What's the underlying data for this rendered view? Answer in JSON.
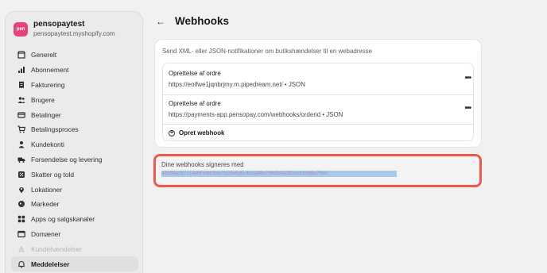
{
  "store": {
    "avatar_text": "pen",
    "name": "pensopaytest",
    "domain": "pensopaytest.myshopify.com"
  },
  "nav": [
    {
      "label": "Generelt",
      "icon": "store-icon"
    },
    {
      "label": "Abonnement",
      "icon": "plan-icon"
    },
    {
      "label": "Fakturering",
      "icon": "receipt-icon"
    },
    {
      "label": "Brugere",
      "icon": "users-icon"
    },
    {
      "label": "Betalinger",
      "icon": "card-icon"
    },
    {
      "label": "Betalingsproces",
      "icon": "cart-icon"
    },
    {
      "label": "Kundekonti",
      "icon": "person-icon"
    },
    {
      "label": "Forsendelse og levering",
      "icon": "truck-icon"
    },
    {
      "label": "Skatter og told",
      "icon": "tax-icon"
    },
    {
      "label": "Lokationer",
      "icon": "pin-icon"
    },
    {
      "label": "Markeder",
      "icon": "globe-icon"
    },
    {
      "label": "Apps og salgskanaler",
      "icon": "apps-icon"
    },
    {
      "label": "Domæner",
      "icon": "domain-icon"
    },
    {
      "label": "Kundehændelser",
      "icon": "events-icon"
    },
    {
      "label": "Meddelelser",
      "icon": "bell-icon"
    }
  ],
  "header": {
    "back_icon": "arrow-left-icon",
    "title": "Webhooks"
  },
  "card": {
    "description": "Send XML- eller JSON-notifikationer om butikshændelser til en webadresse",
    "webhooks": [
      {
        "title": "Oprettelse af ordre",
        "url": "https://eoifwe1jqnbrjmy.m.pipedream.net/ • JSON"
      },
      {
        "title": "Oprettelse af ordre",
        "url": "https://payments-app.pensopay.com/webhooks/orderid • JSON"
      }
    ],
    "more_label": "•••",
    "create_label": "Opret webhook"
  },
  "signing": {
    "label": "Dine webhooks signeres med",
    "value": "a9d3f8e2b7c14a6f0e9d2b8c7a1f3e6d5c4b2a9f8e7d6c5b4a3f2e1d0c9b8a7f6e5"
  },
  "colors": {
    "highlight_border": "#ef5a4e",
    "avatar": "#e5437a",
    "selection": "#aac8ec"
  }
}
